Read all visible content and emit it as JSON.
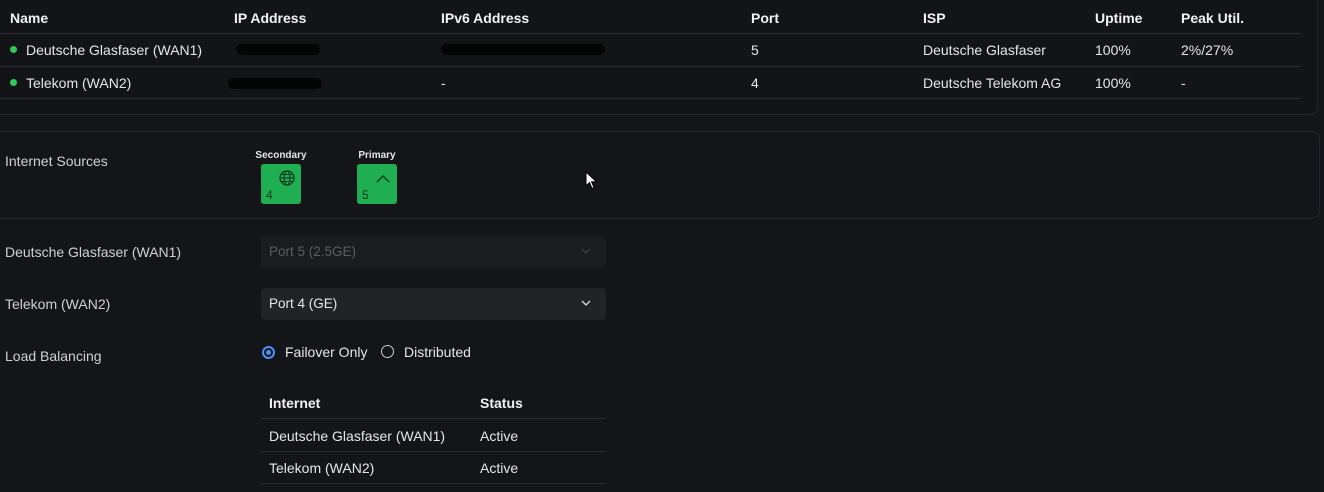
{
  "wan_table": {
    "headers": {
      "name": "Name",
      "ip": "IP Address",
      "ipv6": "IPv6 Address",
      "port": "Port",
      "isp": "ISP",
      "uptime": "Uptime",
      "peak": "Peak Util."
    },
    "rows": [
      {
        "name": "Deutsche Glasfaser (WAN1)",
        "status_color": "#34c759",
        "ip": "",
        "ipv6": "",
        "port": "5",
        "isp": "Deutsche Glasfaser",
        "uptime": "100%",
        "peak": "2%/27%"
      },
      {
        "name": "Telekom (WAN2)",
        "status_color": "#34c759",
        "ip": "",
        "ipv6": "-",
        "port": "4",
        "isp": "Deutsche Telekom AG",
        "uptime": "100%",
        "peak": "-"
      }
    ]
  },
  "internet_sources": {
    "label": "Internet Sources",
    "secondary": {
      "title": "Secondary",
      "number": "4",
      "icon": "globe-icon"
    },
    "primary": {
      "title": "Primary",
      "number": "5",
      "icon": "chevron-up-icon"
    }
  },
  "wan1_port": {
    "label": "Deutsche Glasfaser (WAN1)",
    "value": "Port 5 (2.5GE)",
    "disabled": true
  },
  "wan2_port": {
    "label": "Telekom (WAN2)",
    "value": "Port 4 (GE)",
    "disabled": false
  },
  "load_balancing": {
    "label": "Load Balancing",
    "options": [
      {
        "label": "Failover Only",
        "selected": true
      },
      {
        "label": "Distributed",
        "selected": false
      }
    ]
  },
  "status_table": {
    "headers": {
      "internet": "Internet",
      "status": "Status"
    },
    "rows": [
      {
        "internet": "Deutsche Glasfaser (WAN1)",
        "status": "Active"
      },
      {
        "internet": "Telekom (WAN2)",
        "status": "Active"
      }
    ]
  },
  "colors": {
    "background": "#141518",
    "accent_green": "#1fae52",
    "status_dot": "#34c759",
    "radio_blue": "#4d8ef7"
  }
}
